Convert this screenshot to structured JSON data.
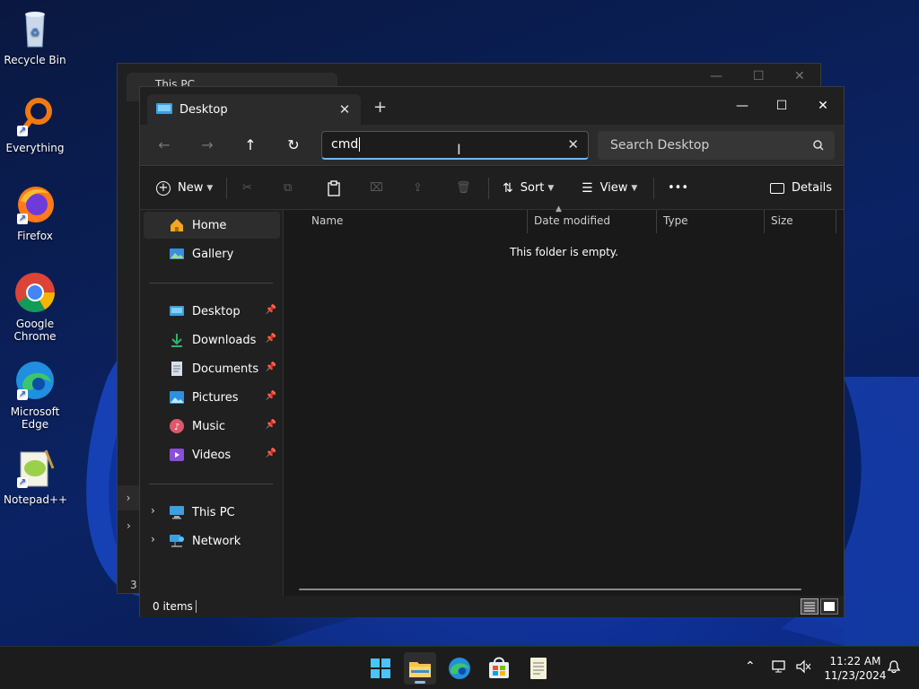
{
  "desktop": {
    "icons": [
      {
        "label": "Recycle Bin",
        "icon": "recycle-bin-icon"
      },
      {
        "label": "Everything",
        "icon": "everything-search-icon"
      },
      {
        "label": "Firefox",
        "icon": "firefox-icon"
      },
      {
        "label": "Google Chrome",
        "icon": "chrome-icon"
      },
      {
        "label": "Microsoft Edge",
        "icon": "edge-icon"
      },
      {
        "label": "Notepad++",
        "icon": "notepadpp-icon"
      }
    ]
  },
  "background_window": {
    "tab_title": "This PC",
    "status_fragment": "3 i"
  },
  "window": {
    "tab_title": "Desktop",
    "tab_close": "✕",
    "new_tab": "+",
    "controls": {
      "minimize": "—",
      "maximize": "☐",
      "close": "✕"
    }
  },
  "nav": {
    "back": "←",
    "forward": "→",
    "up": "↑",
    "refresh": "↻",
    "address_value": "cmd",
    "address_clear": "✕",
    "search_placeholder": "Search Desktop"
  },
  "toolbar": {
    "new_label": "New",
    "sort_label": "Sort",
    "view_label": "View",
    "more_label": "•••",
    "details_label": "Details"
  },
  "sidebar": {
    "top": [
      {
        "label": "Home",
        "icon": "home-icon",
        "selected": true
      },
      {
        "label": "Gallery",
        "icon": "gallery-icon"
      }
    ],
    "pinned": [
      {
        "label": "Desktop",
        "icon": "desktop-folder-icon"
      },
      {
        "label": "Downloads",
        "icon": "downloads-icon"
      },
      {
        "label": "Documents",
        "icon": "documents-icon"
      },
      {
        "label": "Pictures",
        "icon": "pictures-icon"
      },
      {
        "label": "Music",
        "icon": "music-icon"
      },
      {
        "label": "Videos",
        "icon": "videos-icon"
      }
    ],
    "bottom": [
      {
        "label": "This PC",
        "icon": "this-pc-icon"
      },
      {
        "label": "Network",
        "icon": "network-icon"
      }
    ]
  },
  "content": {
    "columns": [
      "Name",
      "Date modified",
      "Type",
      "Size"
    ],
    "empty_message": "This folder is empty."
  },
  "status": {
    "items_count": "0 items"
  },
  "taskbar": {
    "apps": [
      "start-icon",
      "file-explorer-icon",
      "edge-icon",
      "store-icon",
      "notepad-icon"
    ],
    "time": "11:22 AM",
    "date": "11/23/2024"
  },
  "colors": {
    "accent": "#6cb8ff",
    "window_bg": "#191919",
    "toolbar_bg": "#1f1f1f",
    "taskbar_bg": "#1c1c1c"
  }
}
